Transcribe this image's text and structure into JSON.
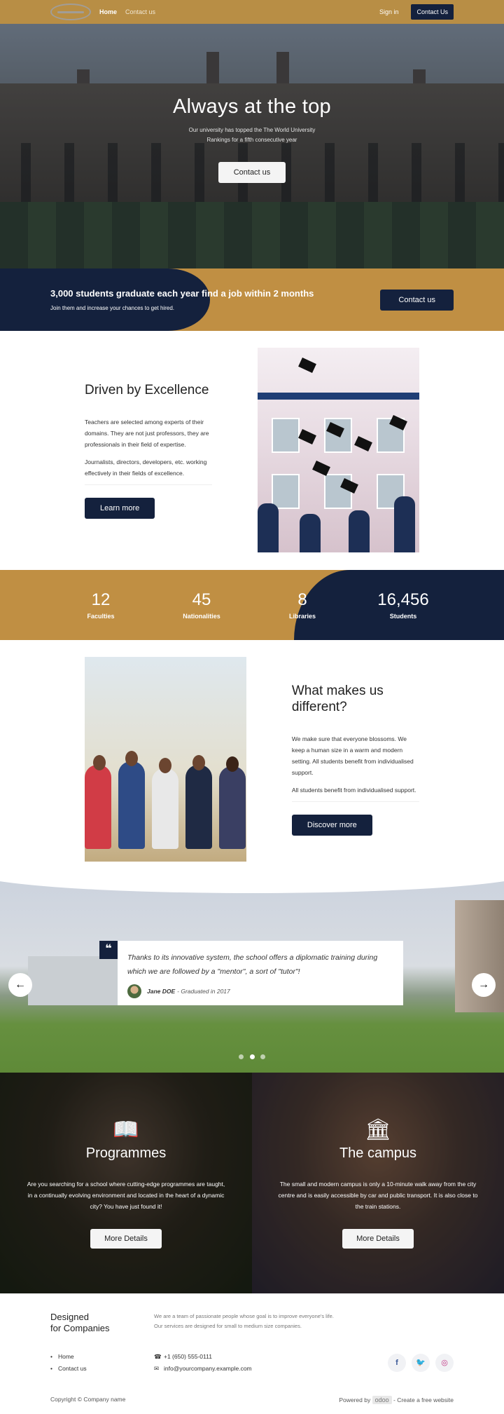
{
  "nav": {
    "home": "Home",
    "contact": "Contact us",
    "signin": "Sign in",
    "cta": "Contact Us"
  },
  "hero": {
    "title": "Always at the top",
    "sub1": "Our university has topped the The World University",
    "sub2": "Rankings for a fifth consecutive year",
    "button": "Contact us"
  },
  "banner": {
    "title": "3,000 students graduate each year find a job within 2 months",
    "sub": "Join them and increase your chances to get hired.",
    "button": "Contact us"
  },
  "driven": {
    "heading": "Driven by Excellence",
    "p1": "Teachers are selected among experts of their domains. They are not just professors, they are professionals in their field of expertise.",
    "p2": "Journalists, directors, developers, etc. working effectively in their fields of excellence.",
    "button": "Learn more"
  },
  "stats": [
    {
      "num": "12",
      "label": "Faculties"
    },
    {
      "num": "45",
      "label": "Nationalities"
    },
    {
      "num": "8",
      "label": "Libraries"
    },
    {
      "num": "16,456",
      "label": "Students"
    }
  ],
  "different": {
    "heading": "What makes us different?",
    "p1": "We make sure that everyone blossoms. We keep a human size in a warm and modern setting. All students benefit from individualised support.",
    "p2": "All students benefit from individualised support.",
    "button": "Discover more"
  },
  "testimonial": {
    "quote": "Thanks to its innovative system, the school offers a diplomatic training during which we are followed by a \"mentor\", a sort of \"tutor\"!",
    "author": "Jane DOE",
    "role": " - Graduated in 2017"
  },
  "features": [
    {
      "title": "Programmes",
      "text": "Are you searching for a school where cutting-edge programmes are taught, in a continually evolving environment and located in the heart of a dynamic city? You have just found it!",
      "button": "More Details",
      "icon": "book-icon"
    },
    {
      "title": "The campus",
      "text": "The small and modern campus is only a 10-minute walk away from the city centre and is easily accessible by car and public transport. It is also close to the train stations.",
      "button": "More Details",
      "icon": "university-icon"
    }
  ],
  "footer": {
    "brand1": "Designed",
    "brand2": "for Companies",
    "about1": "We are a team of passionate people whose goal is to improve everyone's life.",
    "about2": "Our services are designed for small to medium size companies.",
    "links": [
      "Home",
      "Contact us"
    ],
    "phone": "+1 (650) 555-0111",
    "email": "info@yourcompany.example.com",
    "copyright": "Copyright © Company name",
    "powered": "Powered by",
    "odoo": "odoo",
    "create": " - Create a free website"
  },
  "colors": {
    "gold": "#c08f43",
    "navy": "#14213d"
  }
}
